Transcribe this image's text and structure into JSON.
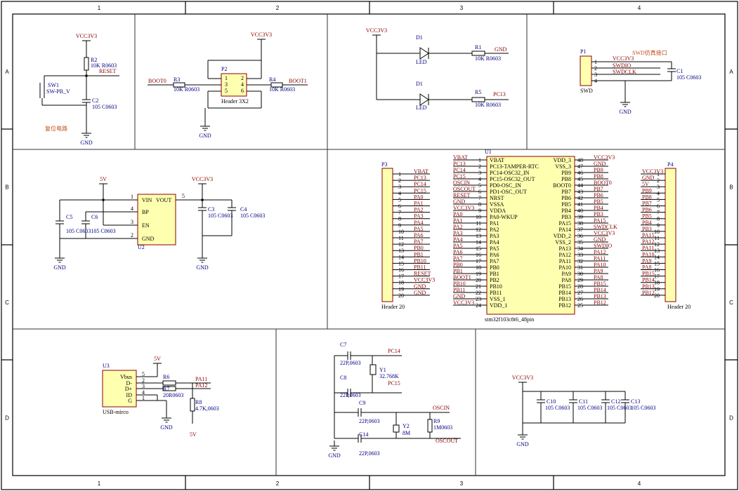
{
  "frame": {
    "columns": [
      "1",
      "2",
      "3",
      "4"
    ],
    "rows": [
      "A",
      "B",
      "C",
      "D"
    ]
  },
  "reset": {
    "vcc": "VCC3V3",
    "r_ref": "R2",
    "r_val": "10K R0603",
    "net": "RESET",
    "sw_ref": "SW1",
    "sw_val": "SW-PB_V",
    "c_ref": "C2",
    "c_val": "105 C0603",
    "gnd": "GND",
    "caption": "复位电路"
  },
  "boot": {
    "vcc": "VCC3V3",
    "net0": "BOOT0",
    "net1": "BOOT1",
    "r3_ref": "R3",
    "r3_val": "10K R0603",
    "r4_ref": "R4",
    "r4_val": "10K R0603",
    "p_ref": "P2",
    "p_val": "Header 3X2",
    "pins": [
      "1",
      "2",
      "3",
      "4",
      "5",
      "6"
    ],
    "gnd": "GND"
  },
  "leds": {
    "vcc": "VCC3V3",
    "d1_ref": "D1",
    "d1_val": "LED",
    "r1_ref": "R1",
    "r1_val": "10K R0603",
    "r1_net": "GND",
    "d2_ref": "D1",
    "d2_val": "LED",
    "r5_ref": "R5",
    "r5_val": "10K R0603",
    "r5_net": "PC13"
  },
  "swd": {
    "p_ref": "P1",
    "p_val": "SWD",
    "title": "SWD仿真接口",
    "pins": [
      "1",
      "2",
      "3",
      "4"
    ],
    "nets": [
      "VCC3V3",
      "SWDIO",
      "SWDCLK"
    ],
    "c_ref": "C1",
    "c_val": "105 C0603",
    "gnd": "GND"
  },
  "ldo": {
    "in_net": "5V",
    "out_net": "VCC3V3",
    "pins_left": [
      "VIN",
      "BP",
      "EN",
      "GND"
    ],
    "pin_right": "VOUT",
    "pin_nums_left": [
      "1",
      "4",
      "3",
      "2"
    ],
    "pin_num_right": "5",
    "u_ref": "U2",
    "c5": "C5",
    "c6": "C6",
    "c56_val": "105 C0603105 C0603",
    "c3": "C3",
    "c3_val": "105 C0603",
    "c4": "C4",
    "c4_val": "105 C0603",
    "gnd": "GND"
  },
  "p3": {
    "ref": "P3",
    "val": "Header 20",
    "nets": [
      "VBAT",
      "PC13",
      "PC14",
      "PC15",
      "PA0",
      "PA1",
      "PA2",
      "PA3",
      "PA4",
      "PA5",
      "PA6",
      "PA7",
      "PB0",
      "PB1",
      "PB10",
      "PB11",
      "RESET",
      "VCC3V3",
      "GND",
      "GND"
    ]
  },
  "mcu": {
    "ref": "U1",
    "val": "stm32f103c8t6_48pin",
    "left_names": [
      "VBAT",
      "PC13-TAMPER-RTC",
      "PC14-OSC32_IN",
      "PC15-OSC32_OUT",
      "PD0-OSC_IN",
      "PD1-OSC_OUT",
      "NRST",
      "VSSA",
      "VDDA",
      "PA0-WKUP",
      "PA1",
      "PA2",
      "PA3",
      "PA4",
      "PA5",
      "PA6",
      "PA7",
      "PB0",
      "PB1",
      "PB2",
      "PB10",
      "PB11",
      "VSS_1",
      "VDD_1"
    ],
    "left_nums": [
      "1",
      "2",
      "3",
      "4",
      "5",
      "6",
      "7",
      "8",
      "9",
      "10",
      "11",
      "12",
      "13",
      "14",
      "15",
      "16",
      "17",
      "18",
      "19",
      "20",
      "21",
      "22",
      "23",
      "24"
    ],
    "left_nets": [
      "VBAT",
      "PC13",
      "PC14",
      "PC15",
      "OSCIN",
      "OSCOUT",
      "RESET",
      "GND",
      "VCC3V3",
      "PA0",
      "PA1",
      "PA2",
      "PA3",
      "PA4",
      "PA5",
      "PA6",
      "PA7",
      "PB0",
      "PB1",
      "BOOT1",
      "PB10",
      "PB11",
      "GND",
      "VCC3V3"
    ],
    "right_names": [
      "VDD_3",
      "VSS_3",
      "PB9",
      "PB8",
      "BOOT0",
      "PB7",
      "PB6",
      "PB5",
      "PB4",
      "PB3",
      "PA15",
      "PA14",
      "VDD_2",
      "VSS_2",
      "PA13",
      "PA12",
      "PA11",
      "PA10",
      "PA9",
      "PA8",
      "PB15",
      "PB14",
      "PB13",
      "PB12"
    ],
    "right_nums": [
      "48",
      "47",
      "46",
      "45",
      "44",
      "43",
      "42",
      "41",
      "40",
      "39",
      "38",
      "37",
      "36",
      "35",
      "34",
      "33",
      "32",
      "31",
      "30",
      "29",
      "28",
      "27",
      "26",
      "25"
    ],
    "right_nets": [
      "VCC3V3",
      "GND",
      "PB9",
      "PB8",
      "BOOT0",
      "PB7",
      "PB6",
      "PB5",
      "PB4",
      "PB3",
      "PA15",
      "SWDCLK",
      "VCC3V3",
      "GND",
      "SWDIO",
      "PA12",
      "PA11",
      "PA10",
      "PA9",
      "PA8",
      "PB15",
      "PB14",
      "PB13",
      "PB12"
    ]
  },
  "p4": {
    "ref": "P4",
    "val": "Header 20",
    "nets": [
      "VCC3V3",
      "GND",
      "5V",
      "PB9",
      "PB8",
      "PB7",
      "PB6",
      "PB5",
      "PB4",
      "PB3",
      "PA15",
      "PA12",
      "PA11",
      "PA10",
      "PA9",
      "PA8",
      "PB15",
      "PB14",
      "PB13",
      "PB12"
    ]
  },
  "usb": {
    "ref": "U3",
    "val": "USB-mirco",
    "vbus": "5V",
    "pins": [
      "Vbus",
      "D-",
      "D+",
      "ID",
      "G"
    ],
    "nums": [
      "5",
      "2",
      "3",
      "4",
      "1"
    ],
    "r6": "R6",
    "r6_val": "20R0603",
    "r7": "R7",
    "r7_val": "20R0603",
    "r8": "R8",
    "r8_val": "4.7K,0603",
    "net_a11": "PA11",
    "net_a12": "PA12",
    "net_5v": "5V",
    "gnd": "GND"
  },
  "xtal": {
    "c7": "C7",
    "c7_val": "22P,0603",
    "c8": "C8",
    "c8_val": "22P,0603",
    "c9": "C9",
    "c9_val": "22P,0603",
    "c14": "C14",
    "c14_val": "22P,0603",
    "y1": "Y1",
    "y1_val": "32.768K",
    "y2": "Y2",
    "y2_val": "8M",
    "r9": "R9",
    "r9_val": "1M0603",
    "pc14": "PC14",
    "pc15": "PC15",
    "oscin": "OSCIN",
    "oscout": "OSCOUT",
    "gnd": "GND"
  },
  "decoup": {
    "vcc": "VCC3V3",
    "caps": [
      "C10",
      "C11",
      "C12",
      "C13"
    ],
    "vals": [
      "105 C0603",
      "105 C0603",
      "105 C0603",
      "105 C0603"
    ],
    "gnd": "GND"
  }
}
